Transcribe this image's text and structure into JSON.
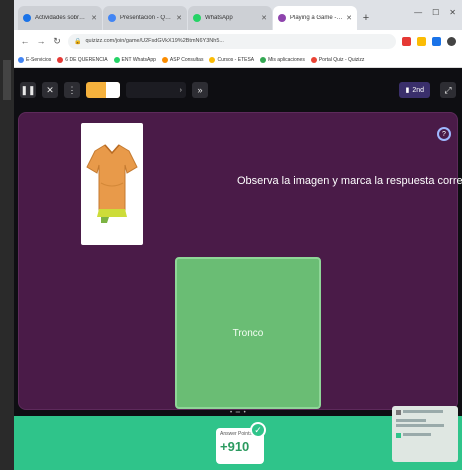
{
  "browser": {
    "tabs": [
      {
        "title": "Actividades sobre la familia",
        "color": "#1a73e8",
        "active": false
      },
      {
        "title": "Presentación - Quizizz",
        "color": "#4285f4",
        "active": false
      },
      {
        "title": "WhatsApp",
        "color": "#25d366",
        "active": false
      },
      {
        "title": "Playing a Game - Quizizz",
        "color": "#8e44ad",
        "active": true
      }
    ],
    "url": "quizizz.com/join/game/U2FsdGVkX19%2BtmN6Y3Nh5...",
    "bookmarks": [
      {
        "label": "E-Servicios",
        "color": "#4285f4"
      },
      {
        "label": "6 DE QUERENCIA",
        "color": "#e53935"
      },
      {
        "label": "ENT WhatsApp",
        "color": "#25d366"
      },
      {
        "label": "ASP Consultas",
        "color": "#fb8c00"
      },
      {
        "label": "Cursos - ETESA",
        "color": "#fbbc05"
      },
      {
        "label": "Mis aplicaciones",
        "color": "#34a853"
      },
      {
        "label": "Portal Quiz - Quizizz",
        "color": "#ea4335"
      }
    ]
  },
  "quiz": {
    "streak_fill": 0.4,
    "counter_label": "2nd",
    "question": "Observa la imagen y marca la respuesta correcta",
    "answer": "Tronco",
    "score_label": "Answer Points",
    "score_value": "+910"
  },
  "colors": {
    "panel": "#4a1b48",
    "answer": "#6abd74",
    "bottom": "#2fc48a"
  }
}
